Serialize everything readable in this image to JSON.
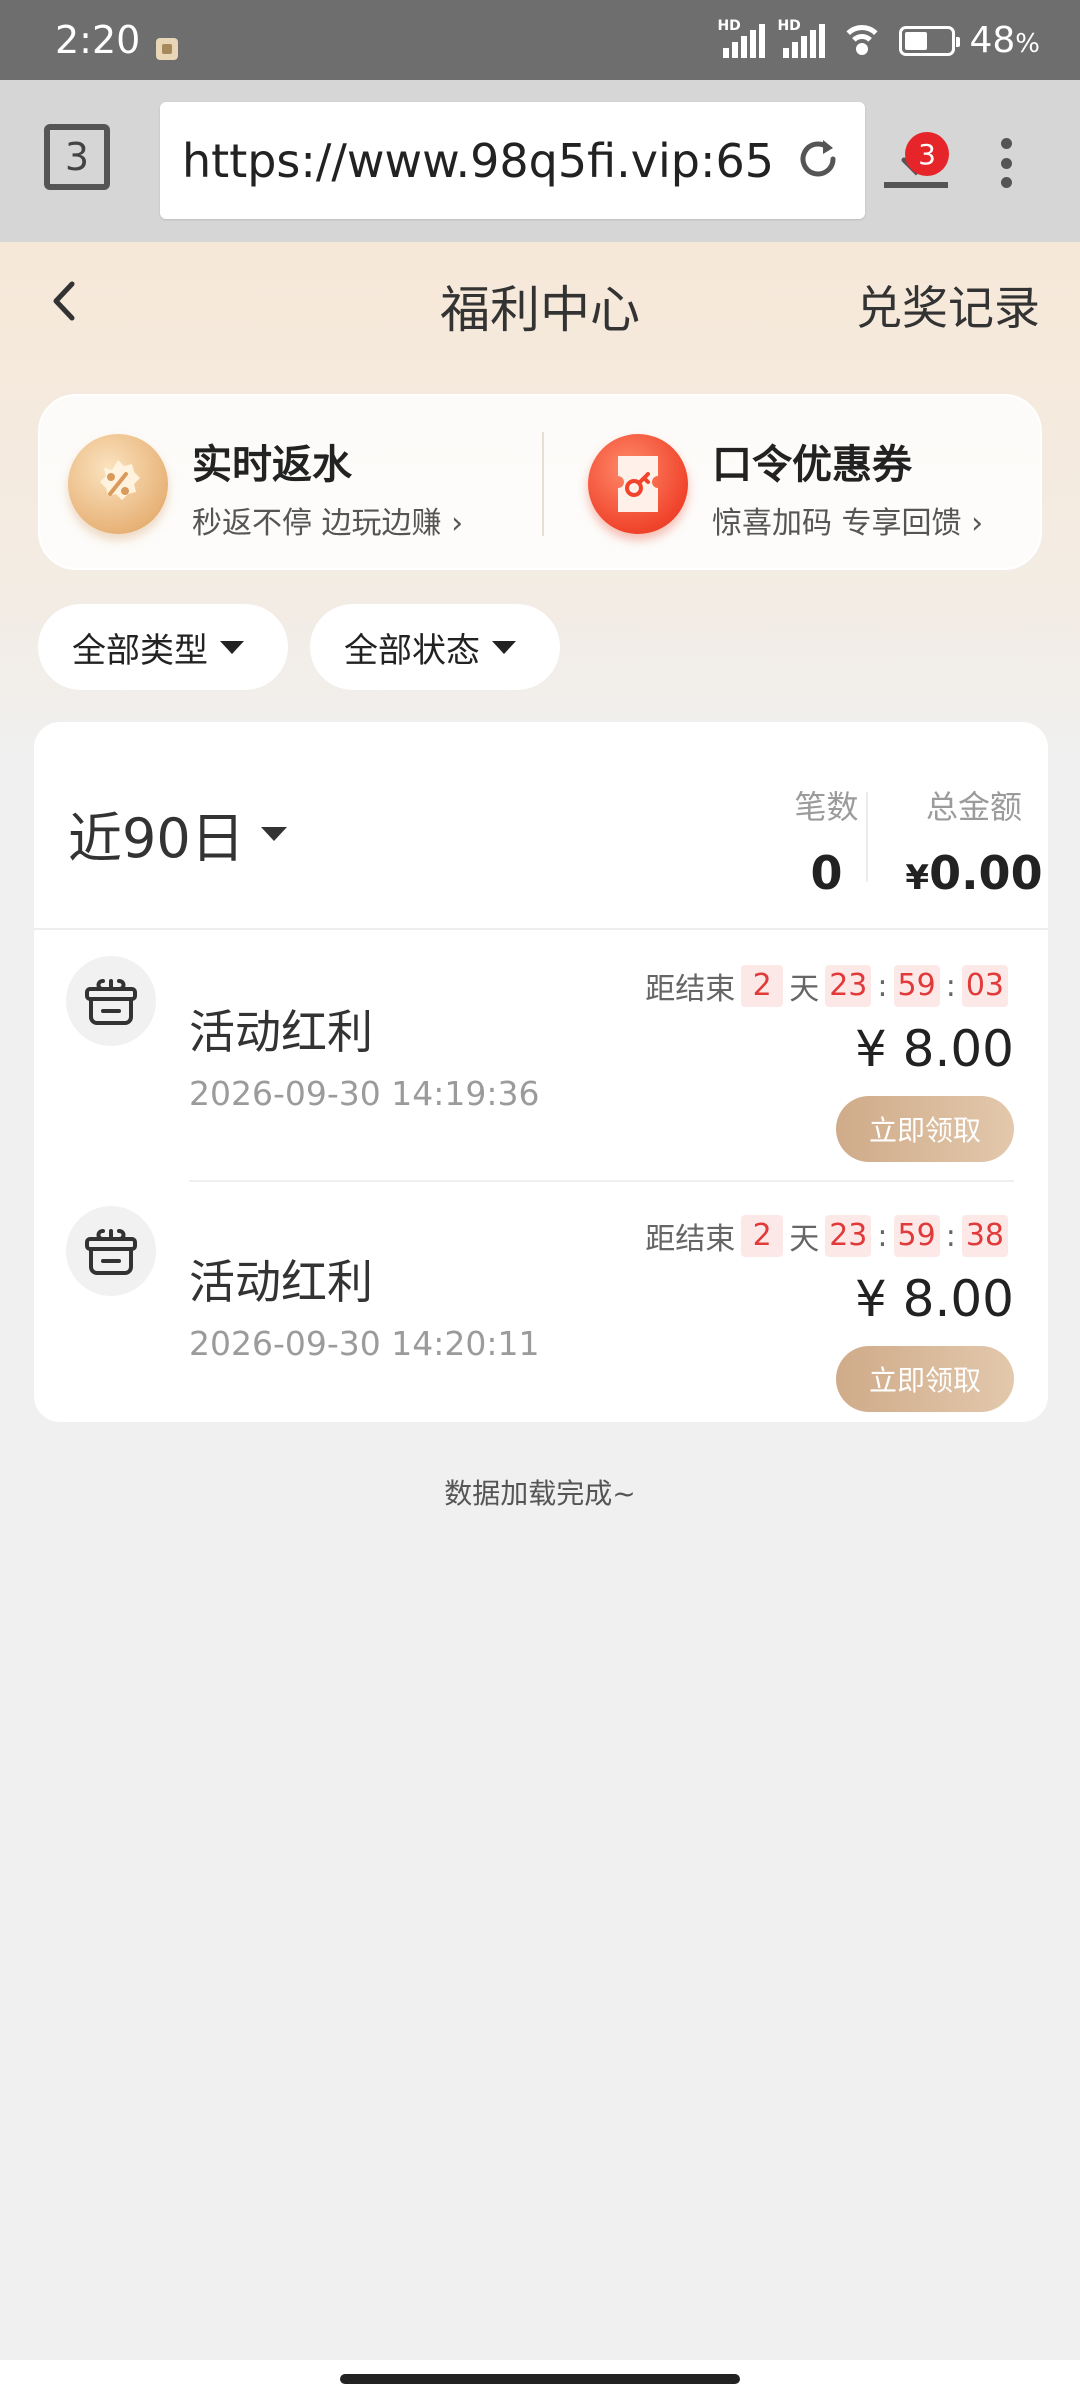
{
  "status_bar": {
    "time": "2:20",
    "signal_label_1": "HD",
    "signal_label_2": "HD",
    "battery_percent": "48",
    "battery_unit": "%"
  },
  "browser": {
    "tab_count": "3",
    "url": "https://www.98q5fi.vip:65",
    "download_badge": "3"
  },
  "header": {
    "title": "福利中心",
    "records_link": "兑奖记录"
  },
  "promos": [
    {
      "title": "实时返水",
      "subtitle": "秒返不停 边玩边赚",
      "icon": "percent-badge-icon",
      "color": "#e8b47a"
    },
    {
      "title": "口令优惠券",
      "subtitle": "惊喜加码 专享回馈",
      "icon": "coupon-icon",
      "color": "#f0452c"
    }
  ],
  "filters": {
    "type": "全部类型",
    "status": "全部状态"
  },
  "summary": {
    "period": "近90日",
    "count_label": "笔数",
    "count_value": "0",
    "total_label": "总金额",
    "total_currency": "¥",
    "total_value": "0.00"
  },
  "items": [
    {
      "title": "活动红利",
      "date": "2026-09-30 14:19:36",
      "countdown_label": "距结束",
      "days": "2",
      "day_unit": "天",
      "hours": "23",
      "minutes": "59",
      "seconds": "03",
      "amount": "¥ 8.00",
      "claim_label": "立即领取"
    },
    {
      "title": "活动红利",
      "date": "2026-09-30 14:20:11",
      "countdown_label": "距结束",
      "days": "2",
      "day_unit": "天",
      "hours": "23",
      "minutes": "59",
      "seconds": "38",
      "amount": "¥ 8.00",
      "claim_label": "立即领取"
    }
  ],
  "footer": {
    "loaded_text": "数据加载完成~"
  },
  "colors": {
    "accent_gold": "#cfab89",
    "countdown_red": "#e03a3a",
    "badge_red": "#e5252a"
  }
}
